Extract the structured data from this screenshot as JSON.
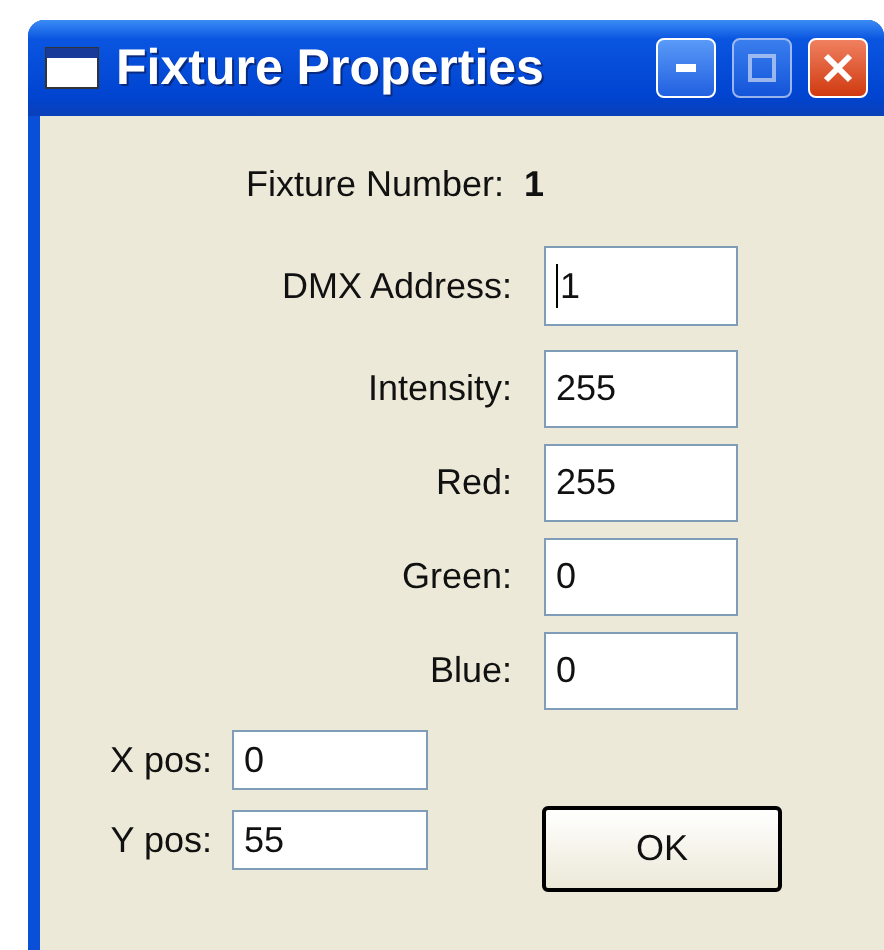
{
  "window": {
    "title": "Fixture Properties"
  },
  "fixture_number": {
    "label": "Fixture Number:",
    "value": "1"
  },
  "fields": [
    {
      "label": "DMX Address:",
      "value": "1",
      "focused": true
    },
    {
      "label": "Intensity:",
      "value": "255",
      "focused": false
    },
    {
      "label": "Red:",
      "value": "255",
      "focused": false
    },
    {
      "label": "Green:",
      "value": "0",
      "focused": false
    },
    {
      "label": "Blue:",
      "value": "0",
      "focused": false
    }
  ],
  "position_fields": [
    {
      "label": "X pos:",
      "value": "0"
    },
    {
      "label": "Y pos:",
      "value": "55"
    }
  ],
  "ok_button": "OK"
}
